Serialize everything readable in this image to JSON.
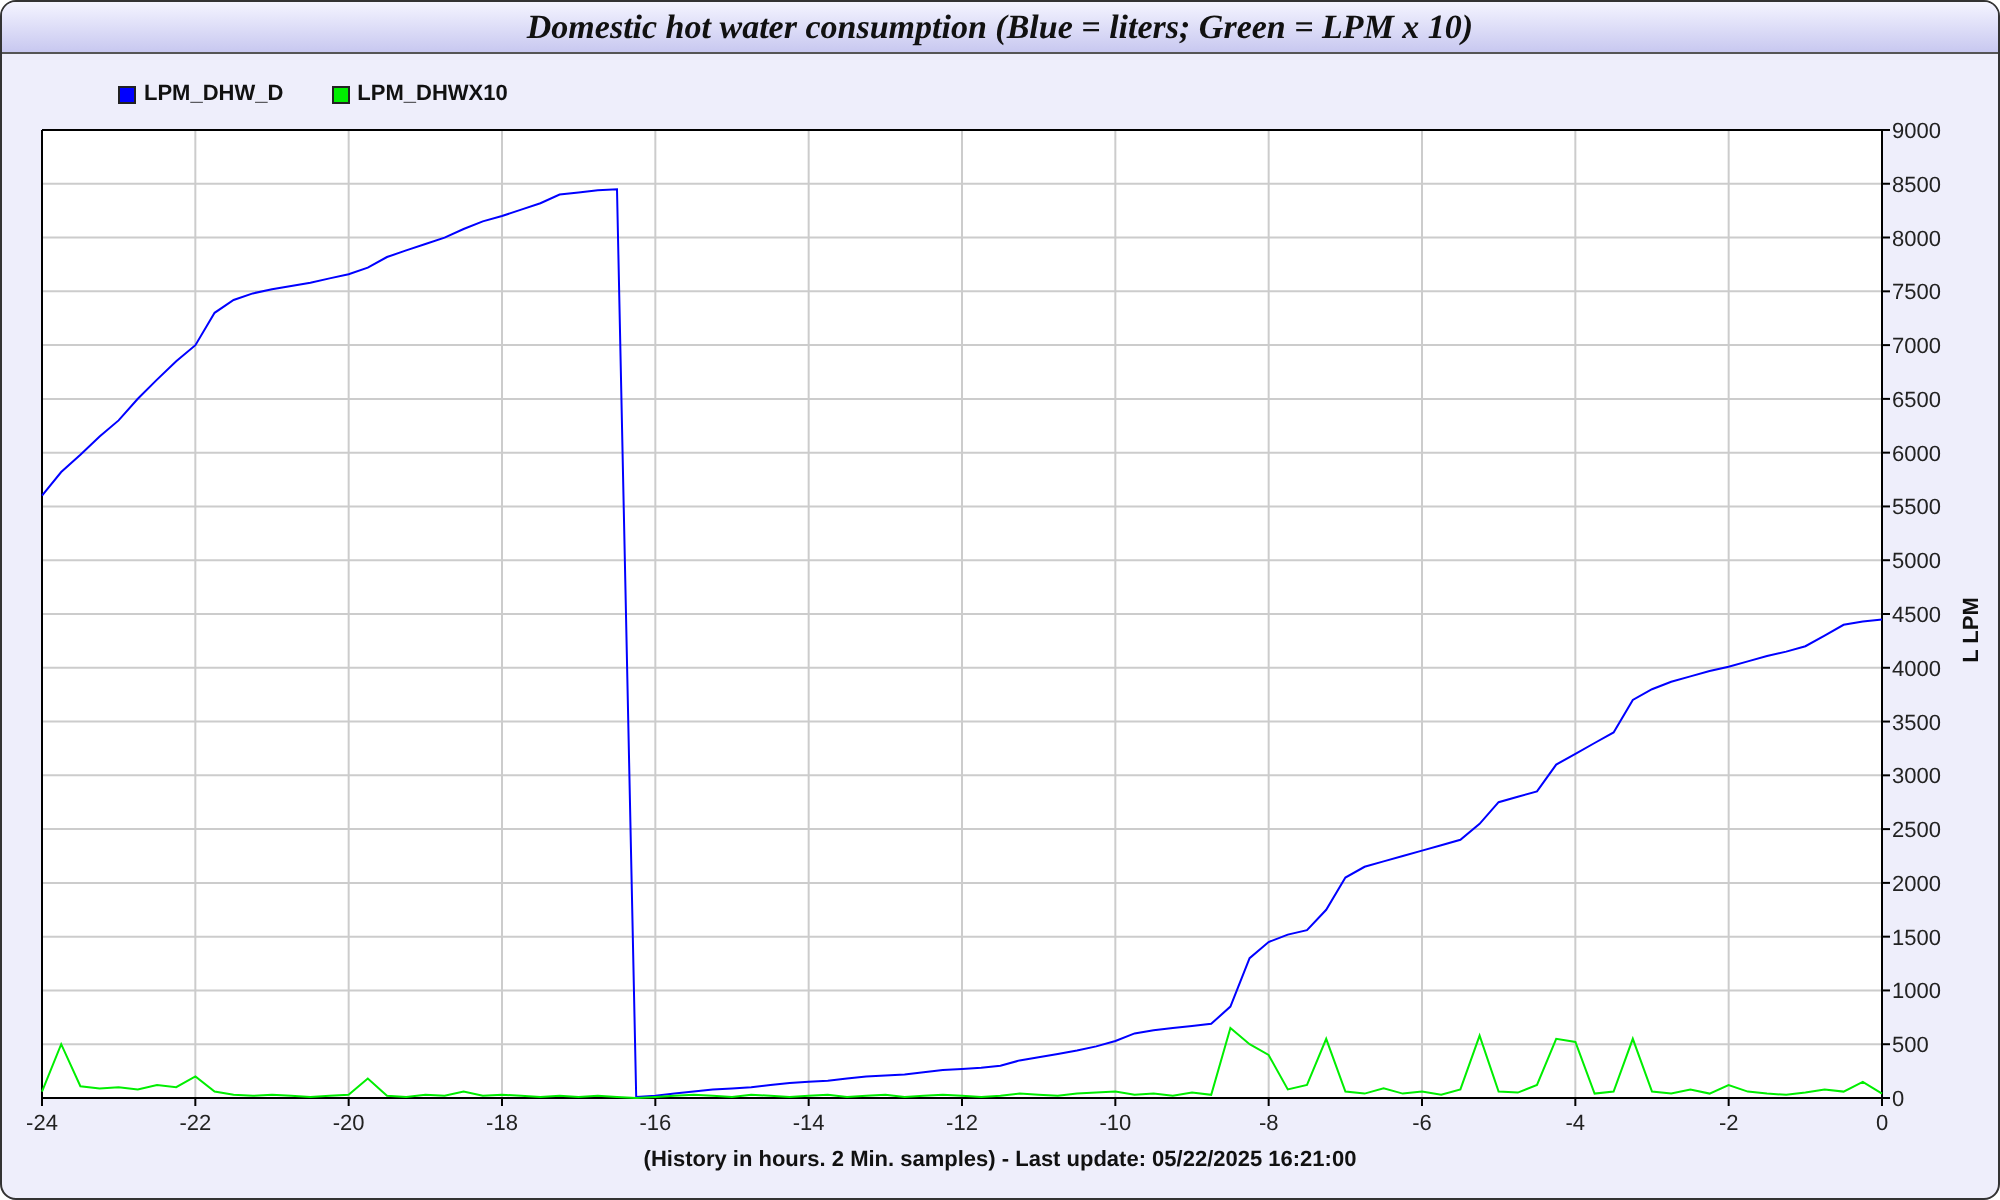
{
  "window": {
    "title": "Domestic hot water consumption (Blue = liters; Green = LPM x 10)"
  },
  "chart_data": {
    "type": "line",
    "xlabel": "(History in hours. 2 Min. samples) - Last update: 05/22/2025 16:21:00",
    "ylabel": "L LPM",
    "x": [
      -24,
      -23.75,
      -23.5,
      -23.25,
      -23,
      -22.75,
      -22.5,
      -22.25,
      -22,
      -21.75,
      -21.5,
      -21.25,
      -21,
      -20.75,
      -20.5,
      -20.25,
      -20,
      -19.75,
      -19.5,
      -19.25,
      -19,
      -18.75,
      -18.5,
      -18.25,
      -18,
      -17.75,
      -17.5,
      -17.25,
      -17,
      -16.75,
      -16.5,
      -16.25,
      -16,
      -15.75,
      -15.5,
      -15.25,
      -15,
      -14.75,
      -14.5,
      -14.25,
      -14,
      -13.75,
      -13.5,
      -13.25,
      -13,
      -12.75,
      -12.5,
      -12.25,
      -12,
      -11.75,
      -11.5,
      -11.25,
      -11,
      -10.75,
      -10.5,
      -10.25,
      -10,
      -9.75,
      -9.5,
      -9.25,
      -9,
      -8.75,
      -8.5,
      -8.25,
      -8,
      -7.75,
      -7.5,
      -7.25,
      -7,
      -6.75,
      -6.5,
      -6.25,
      -6,
      -5.75,
      -5.5,
      -5.25,
      -5,
      -4.75,
      -4.5,
      -4.25,
      -4,
      -3.75,
      -3.5,
      -3.25,
      -3,
      -2.75,
      -2.5,
      -2.25,
      -2,
      -1.75,
      -1.5,
      -1.25,
      -1,
      -0.75,
      -0.5,
      -0.25,
      0
    ],
    "series": [
      {
        "name": "LPM_DHW_D",
        "color": "#0000ff",
        "values": [
          5600,
          5820,
          5980,
          6150,
          6300,
          6500,
          6680,
          6850,
          7000,
          7300,
          7420,
          7480,
          7520,
          7550,
          7580,
          7620,
          7660,
          7720,
          7820,
          7880,
          7940,
          8000,
          8080,
          8150,
          8200,
          8260,
          8320,
          8400,
          8420,
          8440,
          8450,
          10,
          20,
          40,
          60,
          80,
          90,
          100,
          120,
          140,
          150,
          160,
          180,
          200,
          210,
          220,
          240,
          260,
          270,
          280,
          300,
          350,
          380,
          410,
          440,
          480,
          530,
          600,
          630,
          650,
          670,
          690,
          850,
          1300,
          1450,
          1520,
          1560,
          1750,
          2050,
          2150,
          2200,
          2250,
          2300,
          2350,
          2400,
          2550,
          2750,
          2800,
          2850,
          3100,
          3200,
          3300,
          3400,
          3700,
          3800,
          3870,
          3920,
          3970,
          4010,
          4060,
          4110,
          4150,
          4200,
          4300,
          4400,
          4430,
          4450
        ]
      },
      {
        "name": "LPM_DHWX10",
        "color": "#00ee00",
        "values": [
          60,
          500,
          110,
          90,
          100,
          80,
          120,
          100,
          200,
          60,
          30,
          20,
          30,
          20,
          10,
          20,
          30,
          180,
          20,
          10,
          30,
          20,
          60,
          20,
          30,
          20,
          10,
          20,
          10,
          20,
          10,
          0,
          10,
          20,
          30,
          20,
          10,
          30,
          20,
          10,
          20,
          30,
          10,
          20,
          30,
          10,
          20,
          30,
          20,
          10,
          20,
          40,
          30,
          20,
          40,
          50,
          60,
          30,
          40,
          20,
          50,
          30,
          650,
          500,
          400,
          80,
          120,
          550,
          60,
          40,
          90,
          40,
          60,
          30,
          80,
          580,
          60,
          50,
          120,
          550,
          520,
          40,
          60,
          550,
          60,
          40,
          80,
          40,
          120,
          60,
          40,
          30,
          50,
          80,
          60,
          150,
          40
        ]
      }
    ],
    "grid": true,
    "xlim": [
      -24,
      0
    ],
    "ylim": [
      0,
      9000
    ],
    "xticks": [
      -24,
      -22,
      -20,
      -18,
      -16,
      -14,
      -12,
      -10,
      -8,
      -6,
      -4,
      -2,
      0
    ],
    "yticks": [
      0,
      500,
      1000,
      1500,
      2000,
      2500,
      3000,
      3500,
      4000,
      4500,
      5000,
      5500,
      6000,
      6500,
      7000,
      7500,
      8000,
      8500,
      9000
    ]
  }
}
